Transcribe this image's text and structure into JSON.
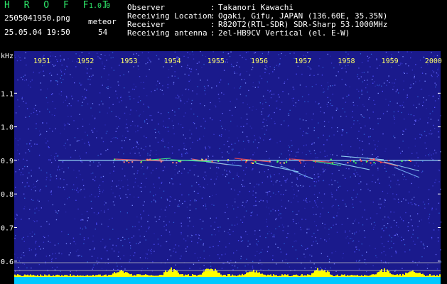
{
  "header": {
    "app_title": "H R O F F T",
    "version": "1.0.0",
    "filename": "2505041950.png",
    "meteor_label": "meteor",
    "timestamp": "25.05.04 19:50",
    "meteor_count": "54"
  },
  "info": [
    {
      "key": "Observer",
      "value": "Takanori Kawachi"
    },
    {
      "key": "Receiving Location",
      "value": "Ogaki, Gifu, JAPAN (136.60E, 35.35N)"
    },
    {
      "key": "Receiver",
      "value": "R820T2(RTL-SDR) SDR-Sharp 53.1000MHz"
    },
    {
      "key": "Receiving antenna",
      "value": "2el-HB9CV Vertical (el. E-W)"
    }
  ],
  "separator": ":",
  "chart_data": {
    "type": "heatmap",
    "ylabel": "kHz",
    "y_ticks": [
      "1.1",
      "1.0",
      "0.9",
      "0.8",
      "0.7",
      "0.6"
    ],
    "y_tick_values": [
      1.1,
      1.0,
      0.9,
      0.8,
      0.7,
      0.6
    ],
    "ylim": [
      0.57,
      1.2
    ],
    "x_ticks": [
      "1951",
      "1952",
      "1953",
      "1954",
      "1955",
      "1956",
      "1957",
      "1958",
      "1959",
      "2000"
    ],
    "carrier_khz": 0.9,
    "background_color": "#1a1a8c",
    "activity_color": "#ffff00",
    "baseline_color": "#00c8ff"
  }
}
